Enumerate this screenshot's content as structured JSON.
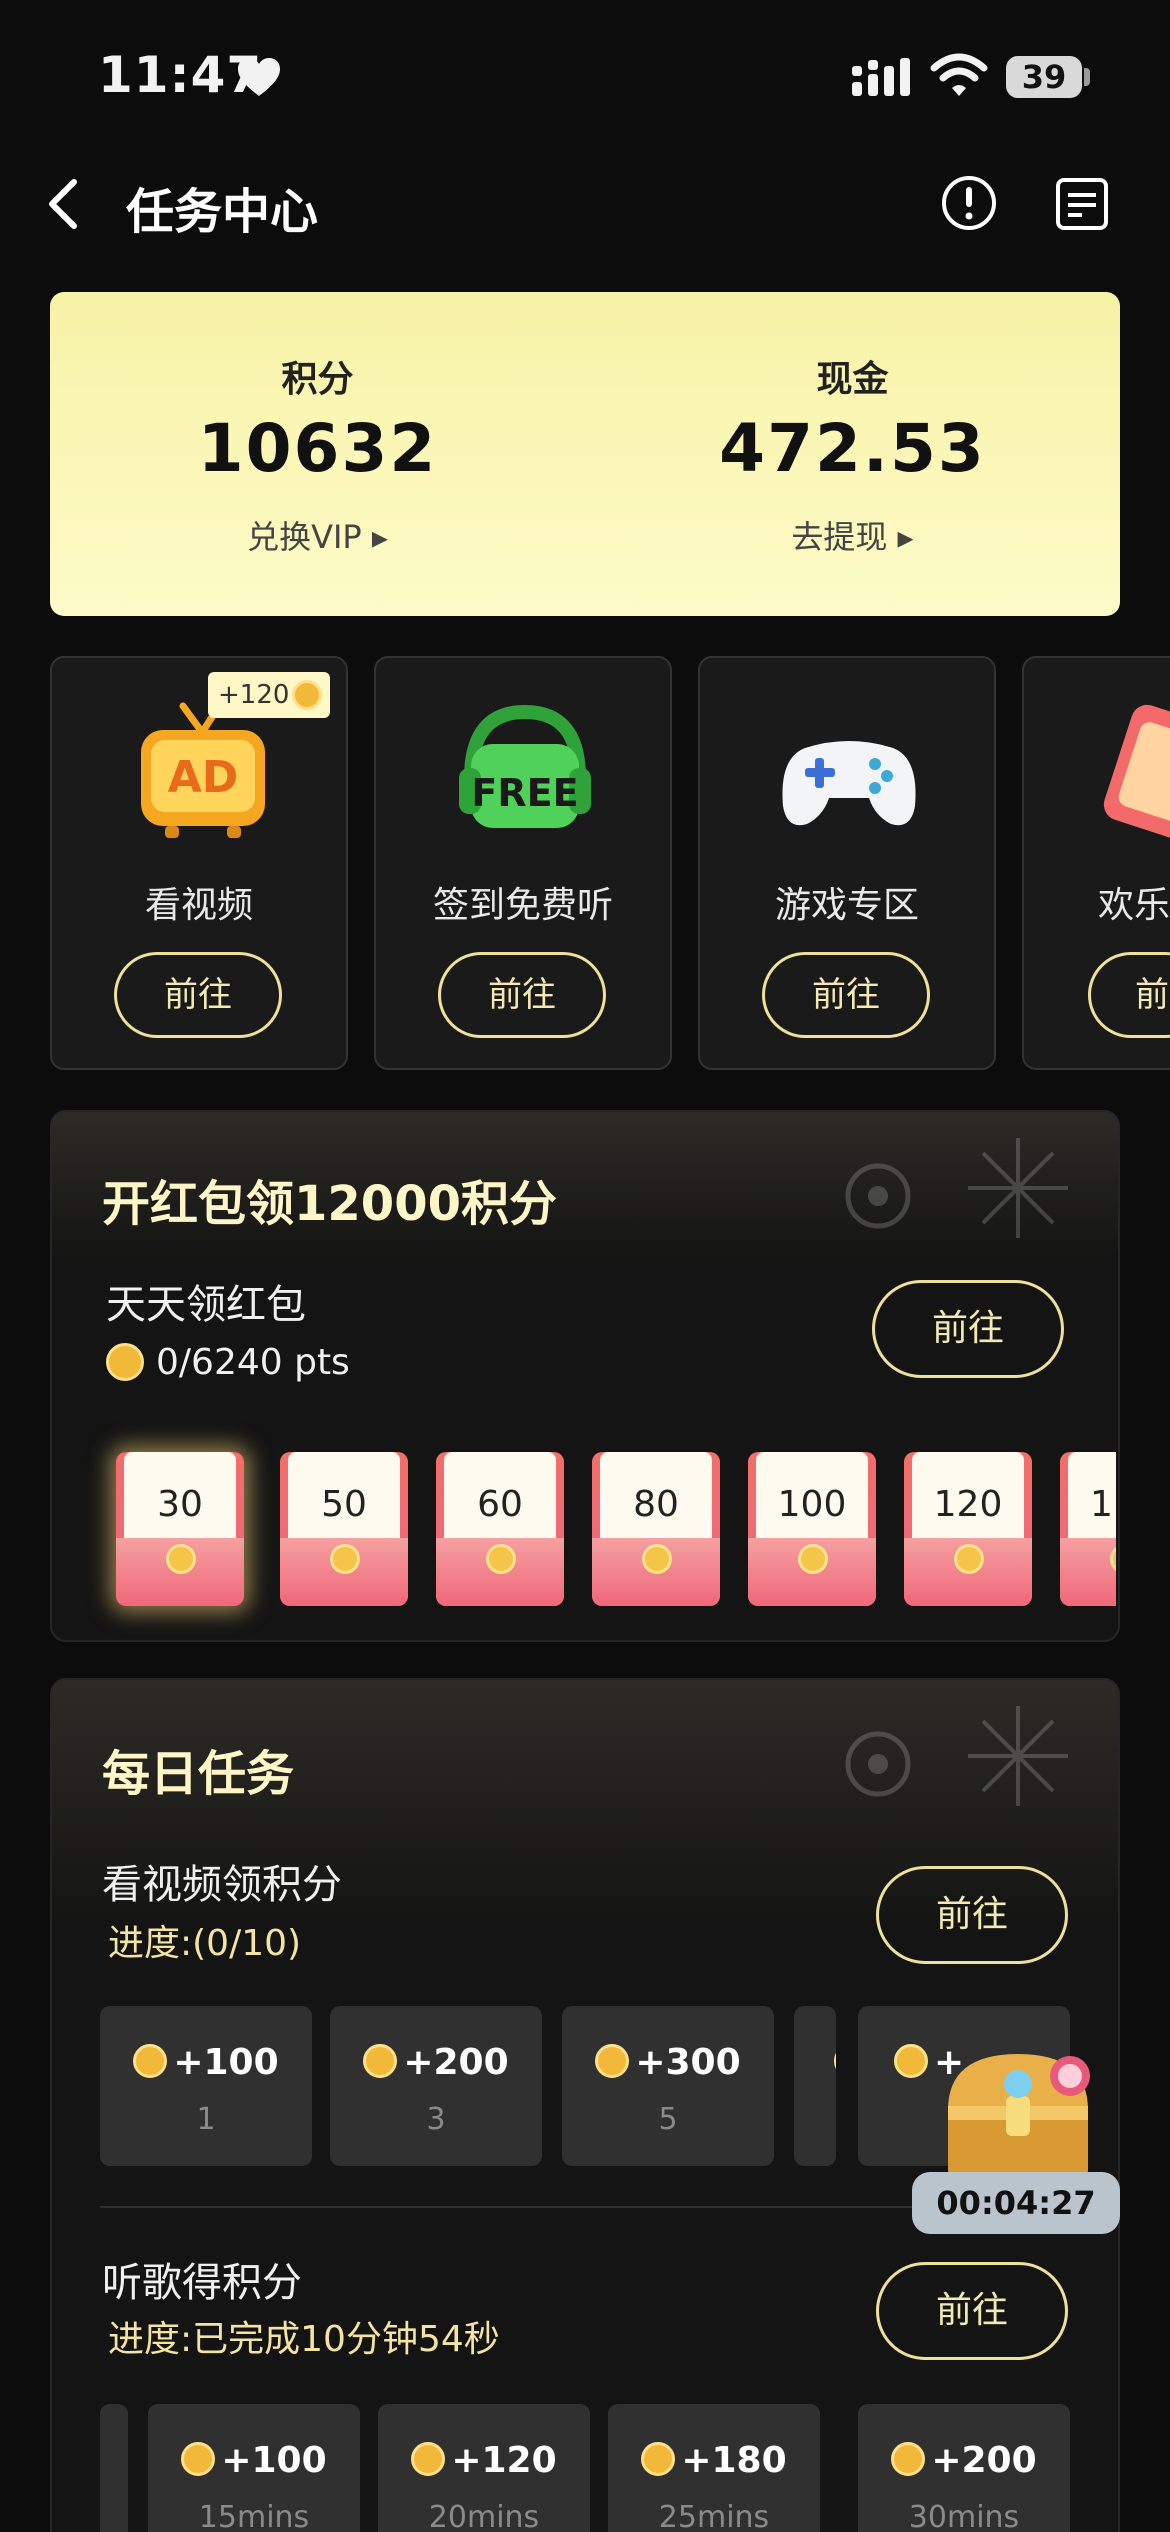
{
  "status_bar": {
    "time": "11:47",
    "battery": "39"
  },
  "nav": {
    "title": "任务中心"
  },
  "balance": {
    "points_label": "积分",
    "points_value": "10632",
    "points_link": "兑换VIP ▸",
    "cash_label": "现金",
    "cash_value": "472.53",
    "cash_link": "去提现 ▸"
  },
  "quick_cards": [
    {
      "label": "看视频",
      "button": "前往",
      "badge": "+120",
      "icon": "ad-tv-icon"
    },
    {
      "label": "签到免费听",
      "button": "前往",
      "icon": "free-headphones-icon"
    },
    {
      "label": "游戏专区",
      "button": "前往",
      "icon": "gamepad-icon"
    },
    {
      "label": "欢乐",
      "button": "前",
      "icon": "card-icon"
    }
  ],
  "red_packet": {
    "title": "开红包领12000积分",
    "subtitle": "天天领红包",
    "progress": "0/6240 pts",
    "button": "前往",
    "envelopes": [
      "30",
      "50",
      "60",
      "80",
      "100",
      "120",
      "1"
    ]
  },
  "daily": {
    "title": "每日任务",
    "video_task": {
      "title": "看视频领积分",
      "progress": "进度:(0/10)",
      "button": "前往",
      "rewards": [
        {
          "amount": "+100",
          "step": "1"
        },
        {
          "amount": "+200",
          "step": "3"
        },
        {
          "amount": "+300",
          "step": "5"
        },
        {
          "amount": "+",
          "step": ""
        },
        {
          "amount": "+",
          "step": ""
        }
      ]
    },
    "music_task": {
      "title": "听歌得积分",
      "progress": "进度:已完成10分钟54秒",
      "button": "前往",
      "rewards": [
        {
          "amount": "+100",
          "step": "15mins"
        },
        {
          "amount": "+120",
          "step": "20mins"
        },
        {
          "amount": "+180",
          "step": "25mins"
        },
        {
          "amount": "+200",
          "step": "30mins"
        }
      ]
    }
  },
  "timer": "00:04:27"
}
